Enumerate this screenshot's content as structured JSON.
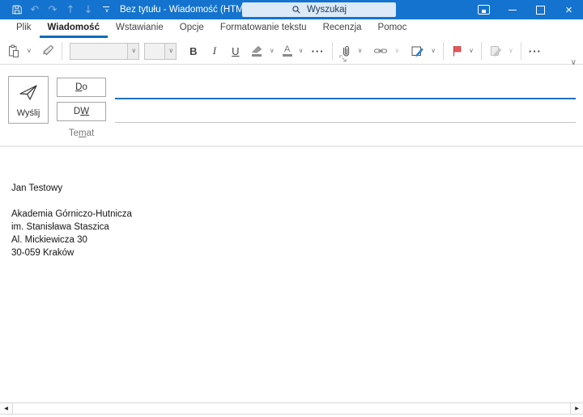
{
  "titlebar": {
    "title": "Bez tytułu - Wiadomość (HTML)",
    "search_label": "Wyszukaj",
    "qat_icons": [
      "save-icon",
      "undo-icon",
      "redo-icon",
      "move-up-icon",
      "move-down-icon",
      "customize-quick-access-toolbar-icon"
    ],
    "window_icons": [
      "ribbon-display-options-icon",
      "minimize-icon",
      "maximize-icon",
      "close-icon"
    ],
    "undo_glyph": "↶",
    "redo_glyph": "↷",
    "up_glyph": "↑",
    "down_glyph": "↓"
  },
  "tabs": [
    {
      "label": "Plik"
    },
    {
      "label": "Wiadomość",
      "active": true
    },
    {
      "label": "Wstawianie"
    },
    {
      "label": "Opcje"
    },
    {
      "label": "Formatowanie tekstu"
    },
    {
      "label": "Recenzja"
    },
    {
      "label": "Pomoc"
    }
  ],
  "ribbon": {
    "icons": [
      "paste-icon",
      "format-painter-icon",
      "highlight-icon",
      "font-color-icon",
      "attach-file-icon",
      "insert-link-icon",
      "signature-icon",
      "follow-up-flag-icon",
      "sensitivity-icon",
      "dialog-launcher-icon",
      "ribbon-collapse-icon"
    ],
    "font_name_value": "",
    "font_size_value": "",
    "bold_label": "B",
    "italic_label": "I",
    "underline_label": "U",
    "text_overflow_label": "···",
    "more_commands_label": "···"
  },
  "compose": {
    "send_label": "Wyślij",
    "to_button": {
      "pre": "",
      "accel": "D",
      "post": "o"
    },
    "cc_button": {
      "pre": "D",
      "accel": "W",
      "post": ""
    },
    "subject_label": {
      "pre": "Te",
      "accel": "m",
      "post": "at"
    },
    "to_value": "",
    "cc_value": "",
    "subject_value": ""
  },
  "body": {
    "lines": [
      "Jan Testowy",
      "",
      "Akademia Górniczo-Hutnicza",
      "im. Stanisława Staszica",
      "Al. Mickiewicza 30",
      "30-059 Kraków"
    ]
  },
  "scrollbar": {
    "left_glyph": "◀",
    "right_glyph": "▶"
  },
  "colors": {
    "titlebar_blue": "#1473ce",
    "tab_accent": "#0f6cbd",
    "focused_field_line": "#2271b8",
    "flag_red": "#e8565c",
    "signature_pen_blue": "#2b7cd3"
  }
}
